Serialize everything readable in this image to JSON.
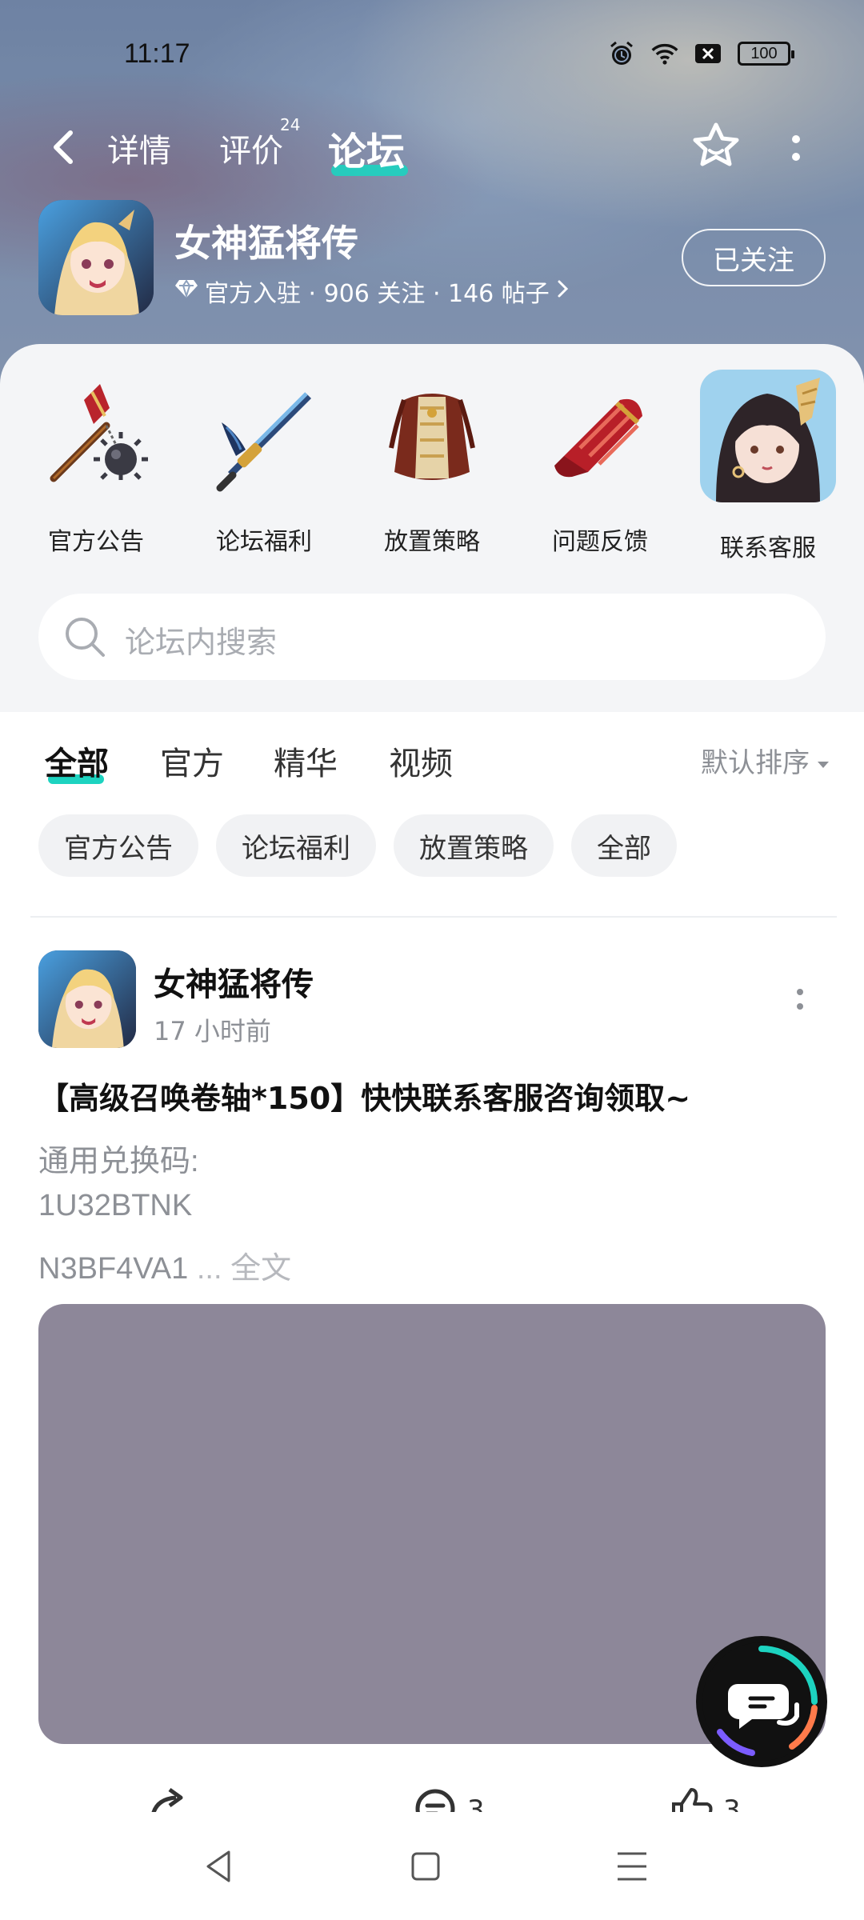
{
  "status_bar": {
    "time": "11:17",
    "battery": "100"
  },
  "nav": {
    "tabs": [
      {
        "label": "详情"
      },
      {
        "label": "评价",
        "badge": "24"
      },
      {
        "label": "论坛"
      }
    ],
    "active_tab": "论坛"
  },
  "game": {
    "title": "女神猛将传",
    "meta": "官方入驻 · 906 关注 · 146 帖子",
    "follow_label": "已关注"
  },
  "sections": [
    {
      "label": "官方公告",
      "icon": "mace-icon"
    },
    {
      "label": "论坛福利",
      "icon": "sword-icon"
    },
    {
      "label": "放置策略",
      "icon": "armor-icon"
    },
    {
      "label": "问题反馈",
      "icon": "gauntlet-icon"
    },
    {
      "label": "联系客服",
      "icon": "customer-service-avatar"
    }
  ],
  "search": {
    "placeholder": "论坛内搜索"
  },
  "content_tabs": [
    "全部",
    "官方",
    "精华",
    "视频"
  ],
  "sort_label": "默认排序",
  "chips": [
    "官方公告",
    "论坛福利",
    "放置策略",
    "全部"
  ],
  "post": {
    "author": "女神猛将传",
    "time": "17 小时前",
    "title": "【高级召唤卷轴*150】快快联系客服咨询领取~",
    "lines": [
      "通用兑换码:",
      "1U32BTNK",
      "N3BF4VA1"
    ],
    "ellipsis": " ...",
    "fulltext": " 全文",
    "comment_count": "3",
    "like_count": "3"
  },
  "colors": {
    "accent": "#1dd3c0",
    "image_placeholder": "#8d8799"
  }
}
